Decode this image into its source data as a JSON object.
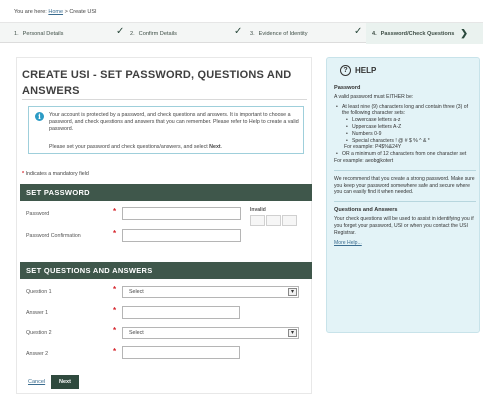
{
  "breadcrumb": {
    "prefix": "You are here:",
    "home": "Home",
    "sep": ">",
    "current": "Create USI"
  },
  "steps": [
    {
      "num": "1.",
      "label": "Personal Details",
      "check": "✓"
    },
    {
      "num": "2.",
      "label": "Confirm Details",
      "check": "✓"
    },
    {
      "num": "3.",
      "label": "Evidence of Identity",
      "check": "✓"
    },
    {
      "num": "4.",
      "label": "Password/Check Questions",
      "chevron": "❯"
    }
  ],
  "page": {
    "title": "CREATE USI - SET PASSWORD, QUESTIONS AND ANSWERS",
    "info_text": "Your account is protected by a password, and check questions and answers. It is important to choose a password, and check questions and answers that you can remember. Please refer to Help to create a valid password.",
    "info_text2_pre": "Please set your password and check questions/answers, and select ",
    "info_text2_bold": "Next",
    "info_text2_post": ".",
    "mandatory_star": "*",
    "mandatory_text": "Indicates a mandatory field"
  },
  "set_password": {
    "heading": "SET PASSWORD",
    "password_label": "Password",
    "confirm_label": "Password Confirmation",
    "strength": "Invalid"
  },
  "questions": {
    "heading": "SET QUESTIONS AND ANSWERS",
    "q1_label": "Question 1",
    "q1_value": "Select",
    "a1_label": "Answer 1",
    "q2_label": "Question 2",
    "q2_value": "Select",
    "a2_label": "Answer 2"
  },
  "actions": {
    "cancel": "Cancel",
    "next": "Next"
  },
  "help": {
    "icon_char": "?",
    "title": "HELP",
    "pw_heading": "Password",
    "pw_intro": "A valid password must EITHER be:",
    "pw_rule1": "At least nine (9) characters long and contain three (3) of the following character sets:",
    "pw_sets": [
      "Lowercase letters a-z",
      "Uppercase letters A-Z",
      "Numbers 0-9",
      "Special characters ! @ # $ % ^ & *"
    ],
    "pw_example1": "For example: P4$%&24Y",
    "pw_rule2": "OR a minimum of 12 characters from one character set",
    "pw_example2": "For example: aeobgjkotert",
    "pw_recommend": "We recommend that you create a strong password. Make sure you keep your password somewhere safe and secure where you can easily find it when needed.",
    "qa_heading": "Questions and Answers",
    "qa_text": "Your check questions will be used to assist in identifying you if you forget your password, USI or when you contact the USI Registrar.",
    "more_help": "More Help..."
  }
}
